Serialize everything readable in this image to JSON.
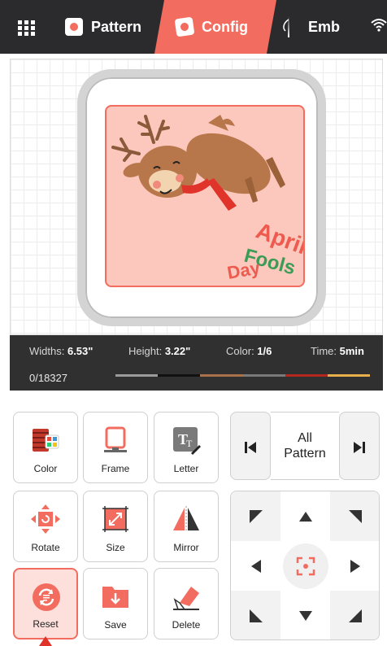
{
  "topbar": {
    "tabs": [
      {
        "label": "Pattern"
      },
      {
        "label": "Config"
      },
      {
        "label": "Emb"
      }
    ]
  },
  "canvas": {
    "design_text": [
      "April",
      "Fools",
      "Day"
    ]
  },
  "info": {
    "width_label": "Widths: ",
    "width_value": "6.53\"",
    "height_label": "Height: ",
    "height_value": "3.22\"",
    "color_label": "Color: ",
    "color_value": "1/6",
    "time_label": "Time: ",
    "time_value": "5min",
    "stitch_count": "0/18327",
    "thread_colors": [
      "#9b9b9b",
      "#111111",
      "#a9714a",
      "#7a7a7a",
      "#b5261f",
      "#e8b04a"
    ]
  },
  "tools": {
    "color": "Color",
    "frame": "Frame",
    "letter": "Letter",
    "rotate": "Rotate",
    "size": "Size",
    "mirror": "Mirror",
    "reset": "Reset",
    "save": "Save",
    "delete": "Delete"
  },
  "pattern_nav": {
    "line1": "All",
    "line2": "Pattern"
  },
  "colors": {
    "accent": "#f26d5f",
    "topbar": "#2b2b2d",
    "design_bg": "#fcc7bd"
  }
}
